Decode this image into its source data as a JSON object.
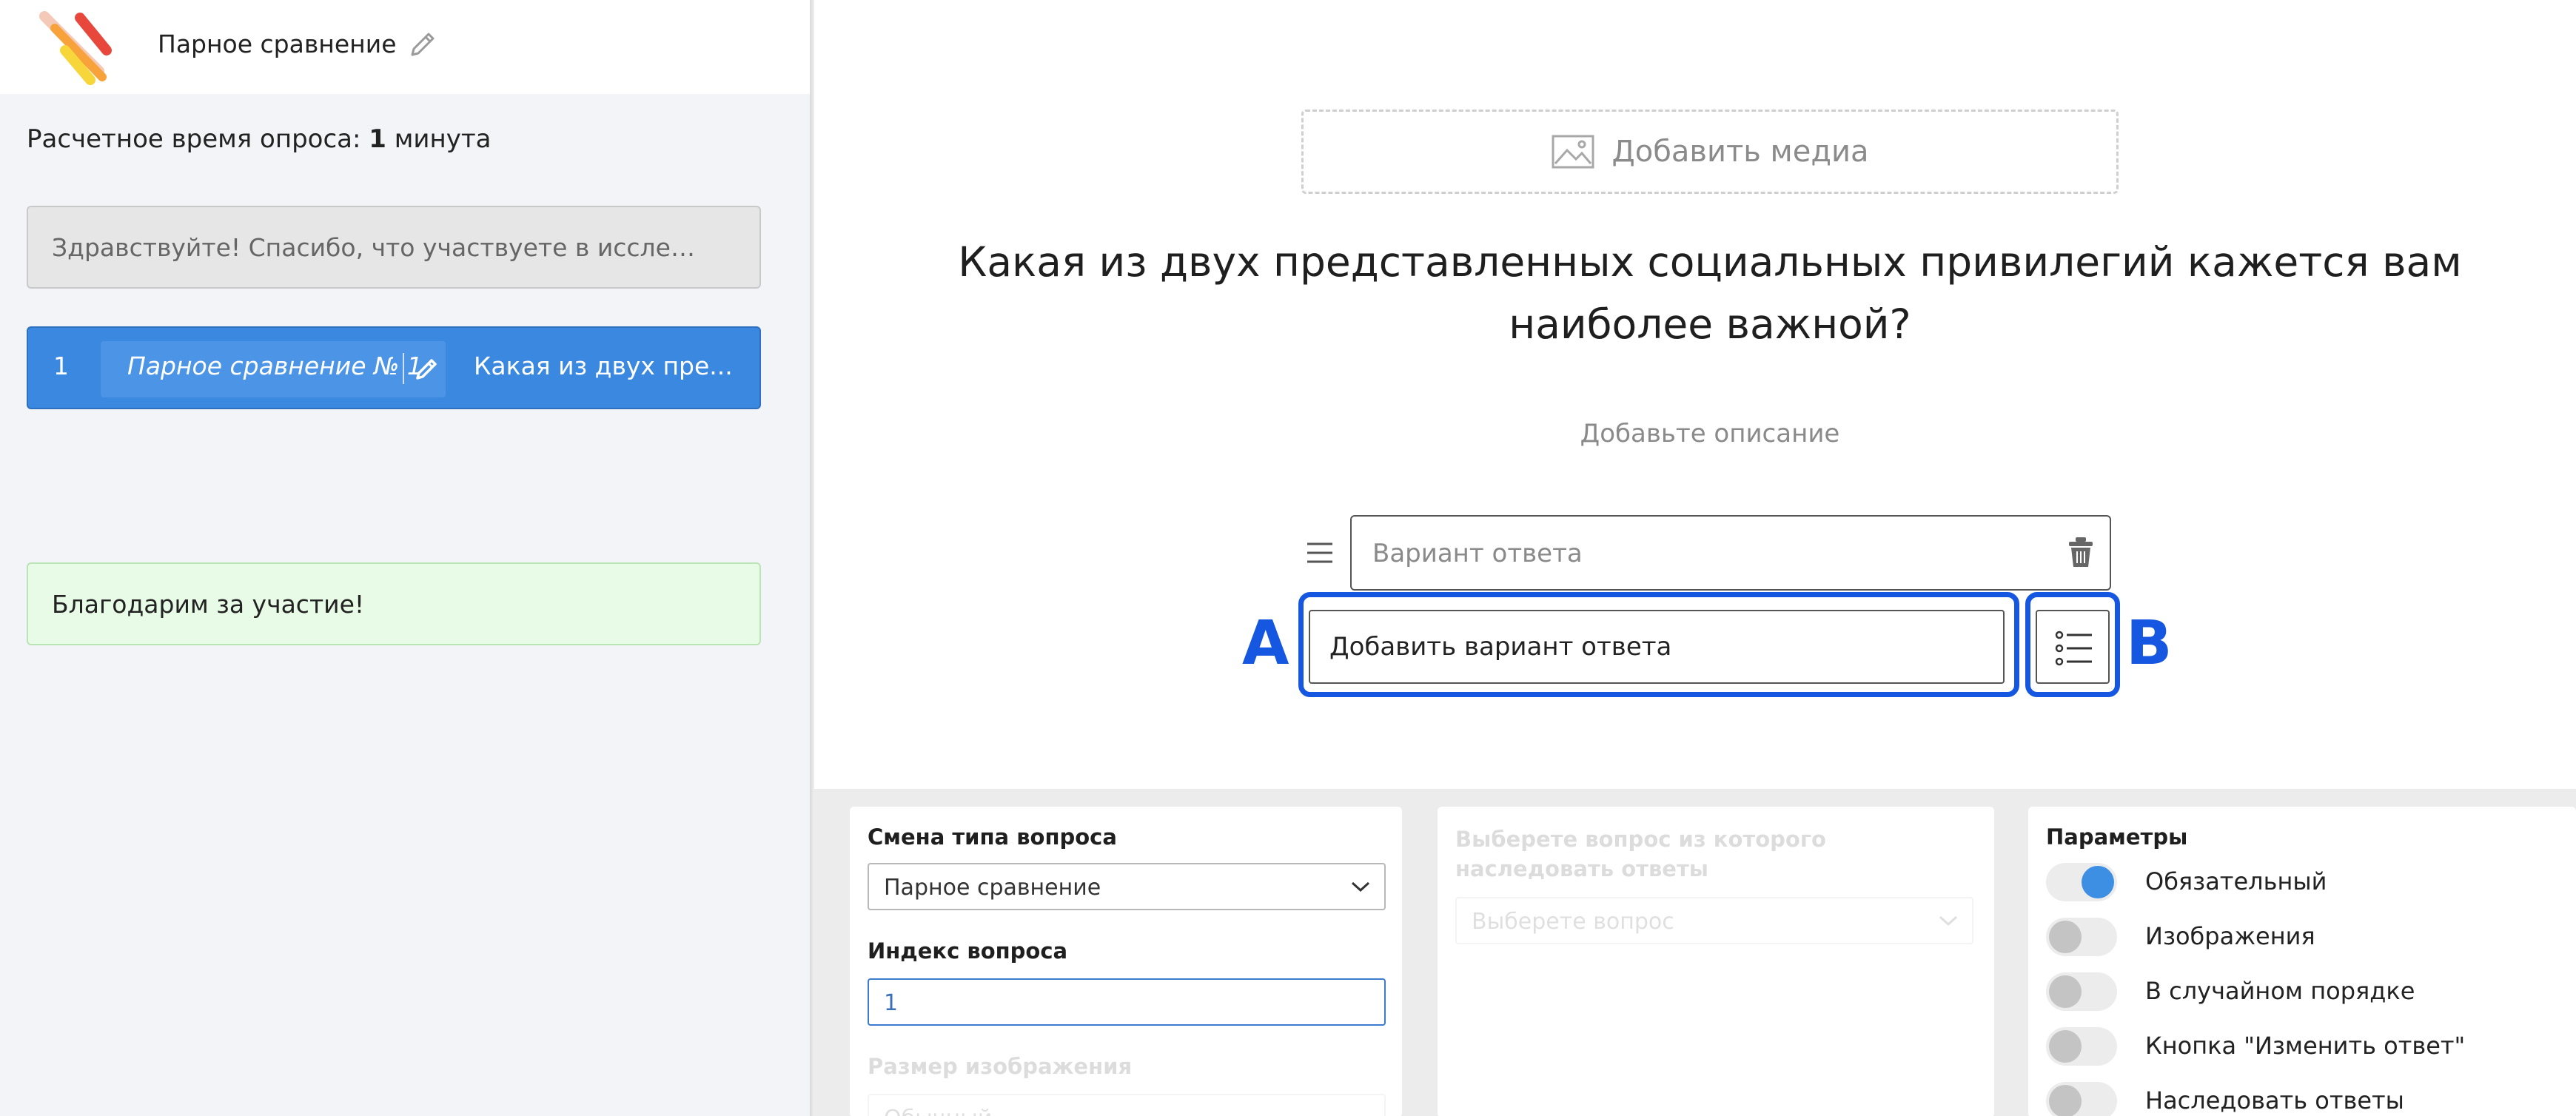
{
  "header": {
    "survey_title": "Парное сравнение"
  },
  "sidebar": {
    "est_time_prefix": "Расчетное время опроса: ",
    "est_time_value": "1",
    "est_time_suffix": " минута",
    "welcome_text": "Здравствуйте! Спасибо, что участвуете в исследов...",
    "question_item": {
      "number": "1",
      "name": "Парное сравнение № 1",
      "text": "Какая из двух пре..."
    },
    "thanks_text": "Благодарим за участие!"
  },
  "editor": {
    "add_media": "Добавить медиа",
    "question_title": "Какая из двух представленных социальных привилегий кажется вам наиболее важной?",
    "add_description": "Добавьте описание",
    "answer_placeholder": "Вариант ответа",
    "add_answer": "Добавить вариант ответа",
    "annotation_a": "A",
    "annotation_b": "B"
  },
  "settings": {
    "change_type_label": "Смена типа вопроса",
    "change_type_value": "Парное сравнение",
    "index_label": "Индекс вопроса",
    "index_value": "1",
    "image_size_label": "Размер изображения",
    "image_size_value": "Обычный",
    "inherit_label": "Выберете вопрос из которого наследовать ответы",
    "inherit_placeholder": "Выберете вопрос",
    "params_label": "Параметры",
    "toggles": [
      {
        "label": "Обязательный",
        "on": true
      },
      {
        "label": "Изображения",
        "on": false
      },
      {
        "label": "В случайном порядке",
        "on": false
      },
      {
        "label": "Кнопка \"Изменить ответ\"",
        "on": false
      },
      {
        "label": "Наследовать ответы",
        "on": false
      }
    ]
  },
  "colors": {
    "accent": "#3b88e0",
    "annotation": "#1557e0",
    "thanks_bg": "#e8fbe6"
  }
}
